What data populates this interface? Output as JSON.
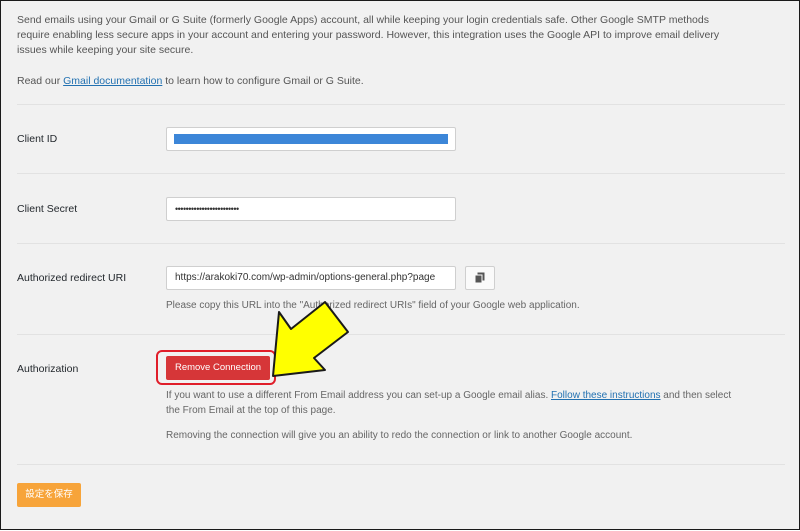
{
  "intro": {
    "paragraph": "Send emails using your Gmail or G Suite (formerly Google Apps) account, all while keeping your login credentials safe. Other Google SMTP methods require enabling less secure apps in your account and entering your password. However, this integration uses the Google API to improve email delivery issues while keeping your site secure.",
    "read_prefix": "Read our ",
    "read_link": "Gmail documentation",
    "read_suffix": " to learn how to configure Gmail or G Suite."
  },
  "fields": {
    "client_id": {
      "label": "Client ID"
    },
    "client_secret": {
      "label": "Client Secret",
      "value": "••••••••••••••••••••••••"
    },
    "redirect_uri": {
      "label": "Authorized redirect URI",
      "value": "https://arakoki70.com/wp-admin/options-general.php?page",
      "help": "Please copy this URL into the \"Authorized redirect URIs\" field of your Google web application."
    }
  },
  "authorization": {
    "label": "Authorization",
    "button": "Remove Connection",
    "help1_prefix": "If you want to use a different From Email address you can set-up a Google email alias. ",
    "help1_link": "Follow these instructions",
    "help1_suffix": " and then select the From Email at the top of this page.",
    "help2": "Removing the connection will give you an ability to redo the connection or link to another Google account."
  },
  "save_button": "設定を保存",
  "colors": {
    "accent_link": "#2271b1",
    "remove_button": "#d63638",
    "save_button": "#f7a43a",
    "annotation_arrow": "#ffff00",
    "annotation_box": "#e01e2a"
  },
  "icons": {
    "copy": "copy-icon",
    "annotation": "arrow-icon"
  }
}
